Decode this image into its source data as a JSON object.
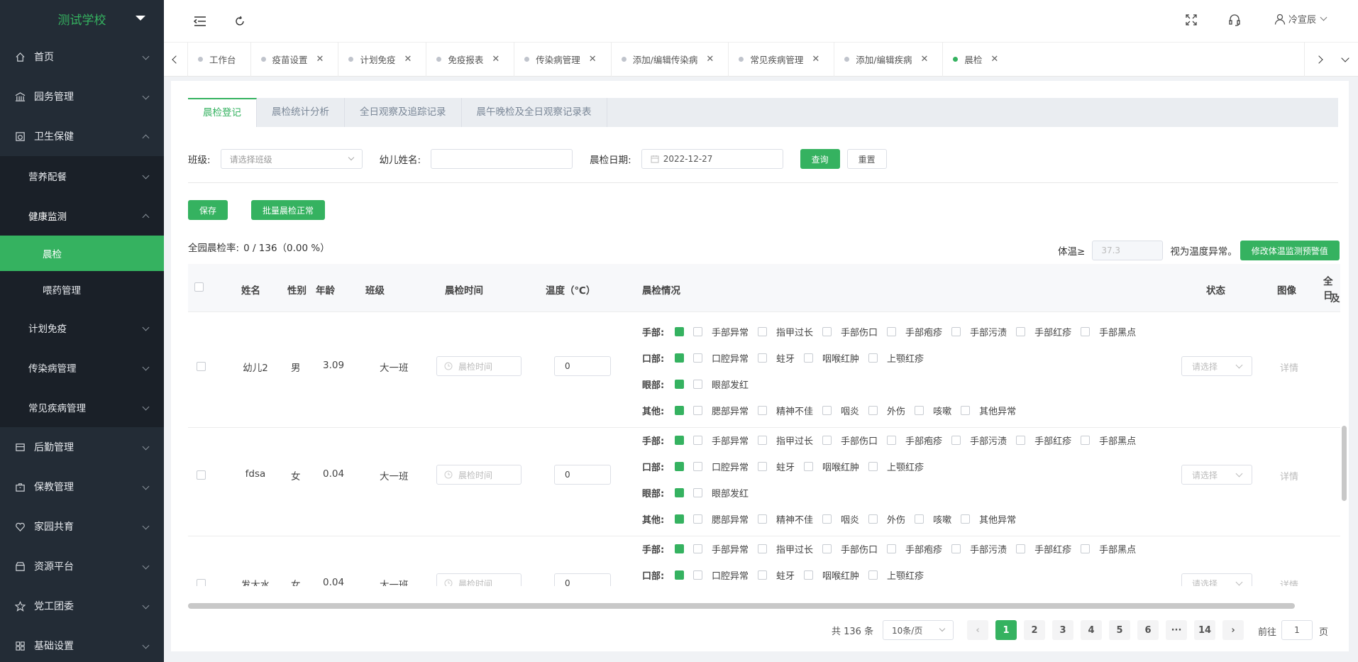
{
  "app": {
    "school": "测试学校",
    "user": "冷宣辰"
  },
  "sidebar": {
    "items": [
      {
        "label": "首页",
        "icon": "home-icon"
      },
      {
        "label": "园务管理",
        "icon": "bank-icon"
      },
      {
        "label": "卫生保健",
        "icon": "health-icon"
      },
      {
        "label": "后勤管理",
        "icon": "logistics-icon"
      },
      {
        "label": "保教管理",
        "icon": "toolbox-icon"
      },
      {
        "label": "家园共育",
        "icon": "heart-icon"
      },
      {
        "label": "资源平台",
        "icon": "box-icon"
      },
      {
        "label": "党工团委",
        "icon": "star-icon"
      },
      {
        "label": "基础设置",
        "icon": "grid-icon"
      }
    ],
    "health_sub": [
      "营养配餐",
      "健康监测",
      "计划免疫",
      "传染病管理",
      "常见疾病管理"
    ],
    "monitor_sub": [
      "晨检",
      "喂药管理"
    ]
  },
  "tabs": [
    "工作台",
    "疫苗设置",
    "计划免疫",
    "免疫报表",
    "传染病管理",
    "添加/编辑传染病",
    "常见疾病管理",
    "添加/编辑疾病",
    "晨检"
  ],
  "subtabs": [
    "晨检登记",
    "晨检统计分析",
    "全日观察及追踪记录",
    "晨午晚检及全日观察记录表"
  ],
  "filter": {
    "class_label": "班级:",
    "class_placeholder": "请选择班级",
    "name_label": "幼儿姓名:",
    "date_label": "晨检日期:",
    "date_value": "2022-12-27",
    "query": "查询",
    "reset": "重置"
  },
  "actions": {
    "save": "保存",
    "batch": "批量晨检正常"
  },
  "stats": {
    "label": "全园晨检率:",
    "value": "0 / 136（0.00 %）",
    "temp_label": "体温≥",
    "temp_value": "37.3",
    "temp_suffix": "视为温度异常。",
    "temp_button": "修改体温监测预警值"
  },
  "table": {
    "headers": {
      "name": "姓名",
      "gender": "性别",
      "age": "年龄",
      "class": "班级",
      "time": "晨检时间",
      "temp": "温度（℃）",
      "cond": "晨检情况",
      "status": "状态",
      "image": "图像",
      "extra1": "全日",
      "extra2": "及"
    },
    "categories": {
      "hand": {
        "label": "手部:",
        "items": [
          "手部异常",
          "指甲过长",
          "手部伤口",
          "手部疱疹",
          "手部污渍",
          "手部红疹",
          "手部黑点"
        ]
      },
      "mouth": {
        "label": "口部:",
        "items": [
          "口腔异常",
          "蛀牙",
          "咽喉红肿",
          "上颚红疹"
        ]
      },
      "eye": {
        "label": "眼部:",
        "items": [
          "眼部发红"
        ]
      },
      "other": {
        "label": "其他:",
        "items": [
          "腮部异常",
          "精神不佳",
          "咽炎",
          "外伤",
          "咳嗽",
          "其他异常"
        ]
      }
    },
    "time_placeholder": "晨检时间",
    "status_placeholder": "请选择",
    "detail": "详情",
    "rows": [
      {
        "name": "幼儿2",
        "gender": "男",
        "age": "3.09",
        "class": "大一班",
        "temp": "0"
      },
      {
        "name": "fdsa",
        "gender": "女",
        "age": "0.04",
        "class": "大一班",
        "temp": "0"
      },
      {
        "name": "发大水",
        "gender": "女",
        "age": "0.04",
        "class": "大一班",
        "temp": "0"
      }
    ]
  },
  "pager": {
    "total": "共 136 条",
    "size": "10条/页",
    "pages": [
      "1",
      "2",
      "3",
      "4",
      "5",
      "6",
      "···",
      "14"
    ],
    "goto": "前往",
    "goto_value": "1",
    "page_unit": "页"
  }
}
